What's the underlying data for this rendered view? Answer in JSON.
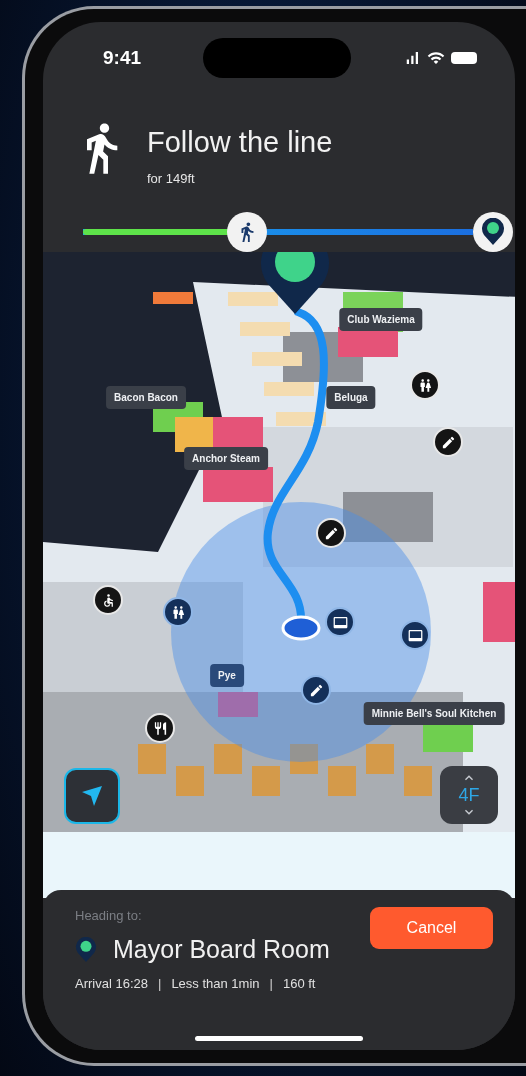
{
  "status_bar": {
    "time": "9:41"
  },
  "instruction": {
    "title": "Follow the line",
    "distance": "for 149ft"
  },
  "progress": {
    "level": 0.42
  },
  "map": {
    "labels": [
      {
        "text": "Club Waziema",
        "kind": "plain"
      },
      {
        "text": "Bacon Bacon",
        "kind": "plain"
      },
      {
        "text": "Beluga",
        "kind": "plain"
      },
      {
        "text": "Anchor Steam",
        "kind": "plain"
      },
      {
        "text": "Pye",
        "kind": "nearby"
      },
      {
        "text": "Minnie Bell's Soul Kitchen",
        "kind": "plain"
      }
    ],
    "pins": [
      {
        "kind": "restroom",
        "nearby": false
      },
      {
        "kind": "pencil",
        "nearby": false
      },
      {
        "kind": "pencil",
        "nearby": false
      },
      {
        "kind": "accessible",
        "nearby": false
      },
      {
        "kind": "restroom",
        "nearby": true
      },
      {
        "kind": "panel",
        "nearby": true
      },
      {
        "kind": "panel",
        "nearby": true
      },
      {
        "kind": "pencil",
        "nearby": true
      },
      {
        "kind": "dining",
        "nearby": false
      }
    ],
    "floor": "4F"
  },
  "destination": {
    "heading": "Heading to:",
    "name": "Mayor Board Room",
    "details": [
      "Arrival 16:28",
      "Less than 1min",
      "160 ft"
    ],
    "separator": "|"
  },
  "cancel_button": "Cancel"
}
